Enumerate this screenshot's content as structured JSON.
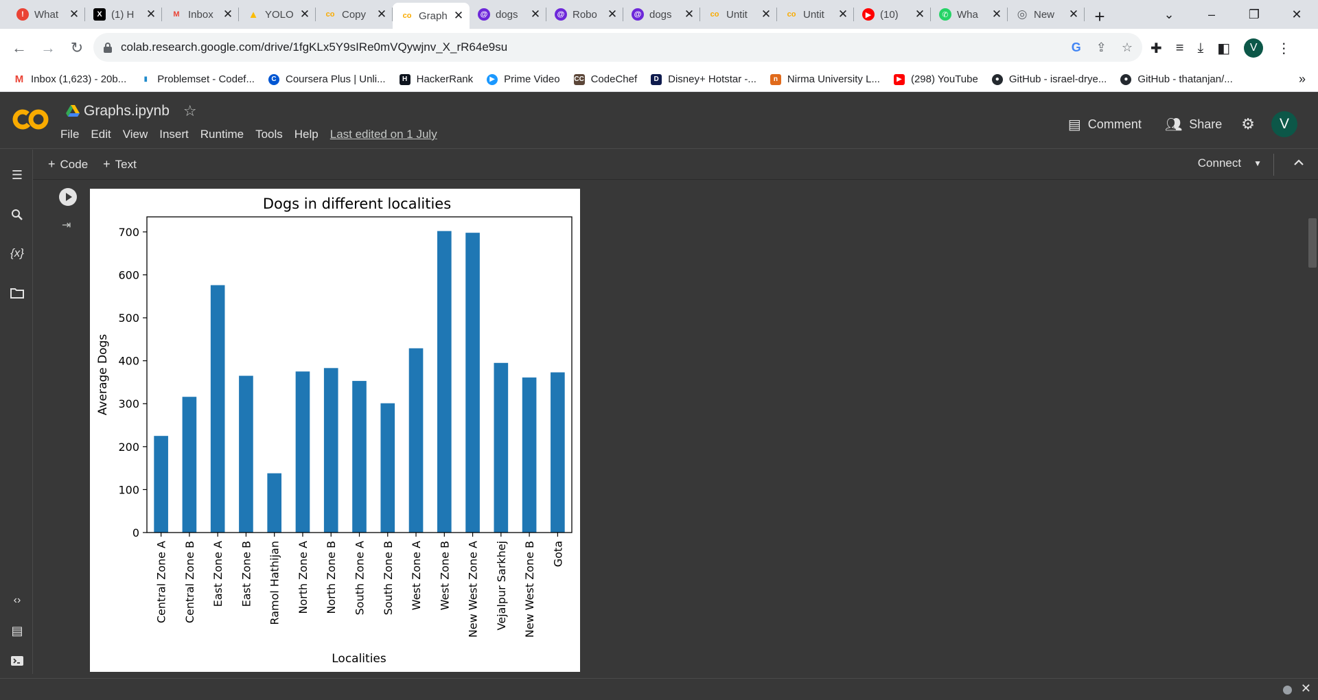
{
  "browser": {
    "tabs": [
      {
        "title": "What",
        "icon": "alert-icon",
        "color": "#ea4335",
        "glyph": "!"
      },
      {
        "title": "(1) H",
        "icon": "x-logo-icon",
        "color": "#000000",
        "glyph": "X"
      },
      {
        "title": "Inbox",
        "icon": "gmail-icon",
        "color": "#ffffff",
        "glyph": "M"
      },
      {
        "title": "YOLO",
        "icon": "drive-icon",
        "color": "#fbbc04",
        "glyph": "▲"
      },
      {
        "title": "Copy",
        "icon": "colab-icon",
        "color": "#f9ab00",
        "glyph": "co"
      },
      {
        "title": "Graph",
        "icon": "colab-icon",
        "color": "#f9ab00",
        "glyph": "co",
        "active": true
      },
      {
        "title": "dogs",
        "icon": "replicate-icon",
        "color": "#6d28d9",
        "glyph": "@"
      },
      {
        "title": "Robo",
        "icon": "replicate-icon",
        "color": "#6d28d9",
        "glyph": "@"
      },
      {
        "title": "dogs",
        "icon": "replicate-icon",
        "color": "#6d28d9",
        "glyph": "@"
      },
      {
        "title": "Untit",
        "icon": "colab-icon",
        "color": "#f9ab00",
        "glyph": "co"
      },
      {
        "title": "Untit",
        "icon": "colab-icon",
        "color": "#f9ab00",
        "glyph": "co"
      },
      {
        "title": "(10)",
        "icon": "youtube-icon",
        "color": "#ff0000",
        "glyph": "▶"
      },
      {
        "title": "Wha",
        "icon": "whatsapp-icon",
        "color": "#25d366",
        "glyph": "✆"
      },
      {
        "title": "New",
        "icon": "chrome-icon",
        "color": "#5f6368",
        "glyph": "◎"
      }
    ],
    "url": "colab.research.google.com/drive/1fgKLx5Y9sIRe0mVQywjnv_X_rR64e9su",
    "bookmarks": [
      {
        "label": "Inbox (1,623) - 20b...",
        "icon": "gmail-icon",
        "color": "#ea4335",
        "glyph": "M"
      },
      {
        "label": "Problemset - Codef...",
        "icon": "codeforces-icon",
        "color": "#1f8acb",
        "glyph": "▮"
      },
      {
        "label": "Coursera Plus | Unli...",
        "icon": "coursera-icon",
        "color": "#0056d2",
        "glyph": "C"
      },
      {
        "label": "HackerRank",
        "icon": "hackerrank-icon",
        "color": "#0e141e",
        "glyph": "H"
      },
      {
        "label": "Prime Video",
        "icon": "prime-video-icon",
        "color": "#1a98ff",
        "glyph": "▶"
      },
      {
        "label": "CodeChef",
        "icon": "codechef-icon",
        "color": "#5b4638",
        "glyph": "CC"
      },
      {
        "label": "Disney+ Hotstar -...",
        "icon": "hotstar-icon",
        "color": "#0f1b4d",
        "glyph": "D"
      },
      {
        "label": "Nirma University L...",
        "icon": "nirma-icon",
        "color": "#e06a1b",
        "glyph": "n"
      },
      {
        "label": "(298) YouTube",
        "icon": "youtube-icon",
        "color": "#ff0000",
        "glyph": "▶"
      },
      {
        "label": "GitHub - israel-drye...",
        "icon": "github-icon",
        "color": "#24292f",
        "glyph": "●"
      },
      {
        "label": "GitHub - thatanjan/...",
        "icon": "github-icon",
        "color": "#24292f",
        "glyph": "●"
      }
    ],
    "bookmarks_more": "»",
    "profile_initial": "V"
  },
  "colab": {
    "doc_title": "Graphs.ipynb",
    "menu": [
      "File",
      "Edit",
      "View",
      "Insert",
      "Runtime",
      "Tools",
      "Help"
    ],
    "last_edited": "Last edited on 1 July",
    "comment_label": "Comment",
    "share_label": "Share",
    "avatar_initial": "V",
    "add_code_label": "Code",
    "add_text_label": "Text",
    "connect_label": "Connect",
    "sidebar_icons": [
      "toc-icon",
      "search-icon",
      "variables-icon",
      "files-icon",
      "code-snippets-icon",
      "command-palette-icon",
      "terminal-icon"
    ]
  },
  "chart_data": {
    "type": "bar",
    "title": "Dogs in different localities",
    "xlabel": "Localities",
    "ylabel": "Average Dogs",
    "categories": [
      "Central Zone A",
      "Central Zone B",
      "East Zone A",
      "East Zone B",
      "Ramol Hathijan",
      "North Zone A",
      "North Zone B",
      "South Zone A",
      "South Zone B",
      "West Zone A",
      "West Zone B",
      "New West Zone A",
      "Vejalpur Sarkhej",
      "New West Zone B",
      "Gota"
    ],
    "values": [
      225,
      316,
      576,
      365,
      138,
      375,
      383,
      353,
      301,
      429,
      702,
      698,
      395,
      361,
      373
    ],
    "yticks": [
      0,
      100,
      200,
      300,
      400,
      500,
      600,
      700
    ],
    "ylim": [
      0,
      735
    ],
    "bar_color": "#1f77b4",
    "grid": false
  }
}
